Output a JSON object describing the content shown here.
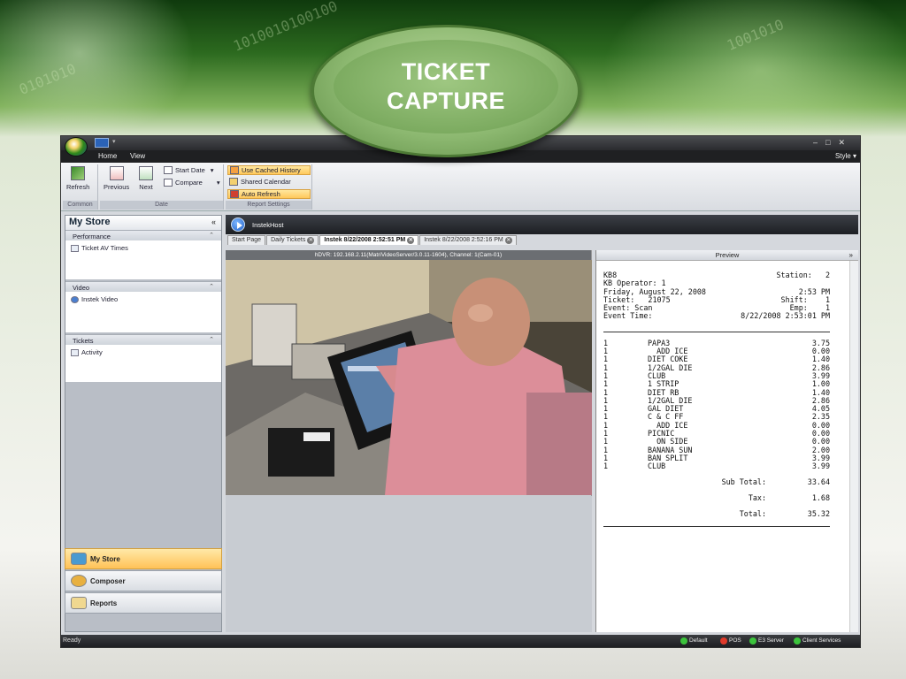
{
  "slide": {
    "title": "TICKET\nCAPTURE"
  },
  "app": {
    "menu": [
      "Home",
      "View"
    ],
    "style_label": "Style ▾",
    "ribbon": {
      "refresh": "Refresh",
      "previous": "Previous",
      "next": "Next",
      "start_date": "Start Date",
      "compare": "Compare",
      "use_cached_history": "Use Cached History",
      "shared_calendar": "Shared Calendar",
      "auto_refresh": "Auto Refresh",
      "groups": [
        "Common",
        "Date",
        "Report Settings"
      ]
    },
    "left": {
      "title": "My Store",
      "sections": [
        {
          "header": "Performance",
          "item": "Ticket AV Times"
        },
        {
          "header": "Video",
          "item": "Instek Video"
        },
        {
          "header": "Tickets",
          "item": "Activity"
        }
      ],
      "nav": [
        "My Store",
        "Composer",
        "Reports"
      ]
    },
    "main": {
      "host": "InstekHost",
      "tabs": [
        "Start Page",
        "Daily Tickets",
        "Instek 8/22/2008 2:52:51 PM",
        "Instek 8/22/2008 2:52:16 PM"
      ],
      "video_caption": "hDVR: 192.168.2.11(MatriVideoServer/3.0.11-1604), Channel: 1(Cam-01)",
      "preview_title": "Preview"
    },
    "receipt": {
      "header": [
        [
          "KB8",
          "Station:   2"
        ],
        [
          "KB Operator: 1",
          ""
        ],
        [
          "Friday, August 22, 2008",
          "2:53 PM"
        ],
        [
          "Ticket:   21075",
          "Shift:    1"
        ],
        [
          "Event: Scan",
          "Emp:    1"
        ],
        [
          "Event Time:",
          "8/22/2008 2:53:01 PM"
        ]
      ],
      "items": [
        [
          "1",
          "PAPA3",
          "3.75"
        ],
        [
          "1",
          "  ADD ICE",
          "0.00"
        ],
        [
          "1",
          "DIET COKE",
          "1.40"
        ],
        [
          "1",
          "1/2GAL DIE",
          "2.86"
        ],
        [
          "1",
          "CLUB",
          "3.99"
        ],
        [
          "1",
          "1 STRIP",
          "1.00"
        ],
        [
          "1",
          "DIET RB",
          "1.40"
        ],
        [
          "1",
          "1/2GAL DIE",
          "2.86"
        ],
        [
          "1",
          "GAL DIET",
          "4.05"
        ],
        [
          "1",
          "C & C FF",
          "2.35"
        ],
        [
          "1",
          "  ADD ICE",
          "0.00"
        ],
        [
          "1",
          "PICNIC",
          "0.00"
        ],
        [
          "1",
          "  ON SIDE",
          "0.00"
        ],
        [
          "1",
          "BANANA SUN",
          "2.00"
        ],
        [
          "1",
          "BAN SPLIT",
          "3.99"
        ],
        [
          "1",
          "CLUB",
          "3.99"
        ]
      ],
      "subtotal_label": "Sub Total:",
      "subtotal": "33.64",
      "tax_label": "Tax:",
      "tax": "1.68",
      "total_label": "Total:",
      "total": "35.32"
    },
    "status": {
      "ready": "Ready",
      "services": [
        "Default",
        "POS",
        "E3 Server",
        "Client Services"
      ]
    }
  }
}
